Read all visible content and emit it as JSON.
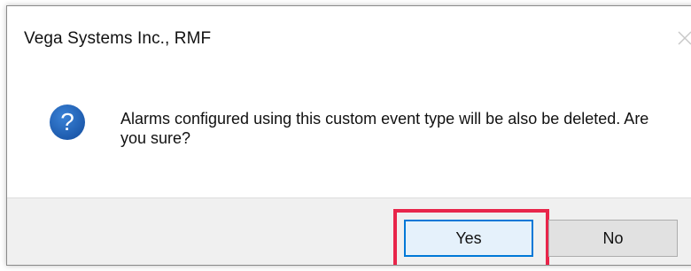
{
  "dialog": {
    "title": "Vega Systems Inc., RMF",
    "close_icon": "close-icon",
    "question_icon": "question-icon",
    "message": "Alarms configured using this custom event type will be also be deleted. Are you sure?",
    "buttons": {
      "yes_label": "Yes",
      "no_label": "No"
    }
  },
  "colors": {
    "highlight": "#e8254a",
    "focus_border": "#0078d7",
    "icon_blue": "#1c5fb4"
  }
}
